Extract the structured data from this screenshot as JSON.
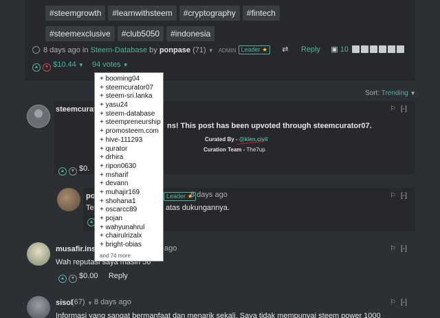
{
  "post": {
    "tags": [
      "#steemgrowth",
      "#learnwithsteem",
      "#cryptography",
      "#fintech",
      "#steemexclusive",
      "#club5050",
      "#indonesia"
    ],
    "age": "8 days ago",
    "in_word": "in",
    "community": "Steem-Database",
    "by_word": "by",
    "author": "ponpase",
    "reputation": "(71)",
    "role": "ADMIN",
    "badge": "Leader",
    "reply_label": "Reply",
    "reblog_count": "10",
    "payout": "$10.44",
    "votes_label": "94 votes"
  },
  "voters": {
    "items": [
      "+ booming04",
      "+ steemcurator07",
      "+ steem-sri.lanka",
      "+ yasu24",
      "+ steem-database",
      "+ steempreneurship",
      "+ promosteem.com",
      "+ hive-111293",
      "+ qurator",
      "+ drhira",
      "+ ripon0630",
      "+ msharif",
      "+ devann",
      "+ muhajir169",
      "+ shohana1",
      "+ oscarcc89",
      "+ pojan",
      "+ wahyunahrul",
      "+ chairulrizalx",
      "+ bright-obias"
    ],
    "more": "and 74 more"
  },
  "sort": {
    "label": "Sort:",
    "value": "Trending"
  },
  "comment1": {
    "author": "steemcurat",
    "title": "ns! This post has been upvoted through steemcurator07.",
    "curated_by_label": "Curated By -",
    "curator": "@klen.civil",
    "team_label": "Curation Team -",
    "team": "The7up",
    "payout": "$0.",
    "tools": "[-]"
  },
  "reply": {
    "author": "po",
    "badge": "Leader",
    "age": "8 days ago",
    "text_start": "Te",
    "text_end": "atas dukungannya.",
    "tools": "[-]"
  },
  "comment2": {
    "author": "musafir.insp",
    "age": "ago",
    "text": "Wah reputasi saya masih 56",
    "payout": "$0.00",
    "reply_label": "Reply",
    "tools": "[-]"
  },
  "comment3": {
    "author": "sisol",
    "reputation": "(67)",
    "age": "8 days ago",
    "text": "Informasi yang sangat bermanfaat dan menarik sekali. Saya tidak mempunyai steem power 1000",
    "tools": "[-]"
  },
  "colors": {
    "accent": "#4fb3a0",
    "background": "#2c2f33",
    "card": "#26282b",
    "highlight": "#d02020"
  }
}
